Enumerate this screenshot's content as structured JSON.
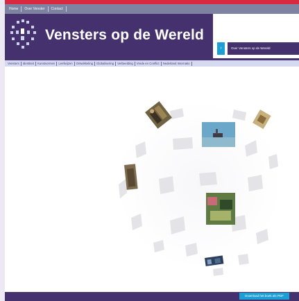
{
  "top_links": [
    "Home",
    "Over Venster",
    "Contact"
  ],
  "header": {
    "site_title": "Vensters op de Wereld",
    "logo_icon": "dotted-window-icon",
    "tab_marker": "›",
    "tab_label": "Over Vensters op de Wereld"
  },
  "nav": {
    "items": [
      "Vensters",
      "Identiteit",
      "Kunstvormen",
      "Leefwijzen",
      "Ontwikkeling",
      "Globalisering",
      "Verbeelding",
      "Vrede en Conflict",
      "Nederland Internatio"
    ]
  },
  "sphere": {
    "photos": [
      "photo-people",
      "photo-ship",
      "photo-building",
      "photo-statue",
      "photo-market",
      "photo-figures"
    ]
  },
  "footer": {
    "download_label": "Download het boek als PDF"
  },
  "colors": {
    "brand_purple": "#45316e",
    "accent_blue": "#1b9fd5",
    "top_red": "#d9283f",
    "nav_bg": "#d6daf0"
  }
}
